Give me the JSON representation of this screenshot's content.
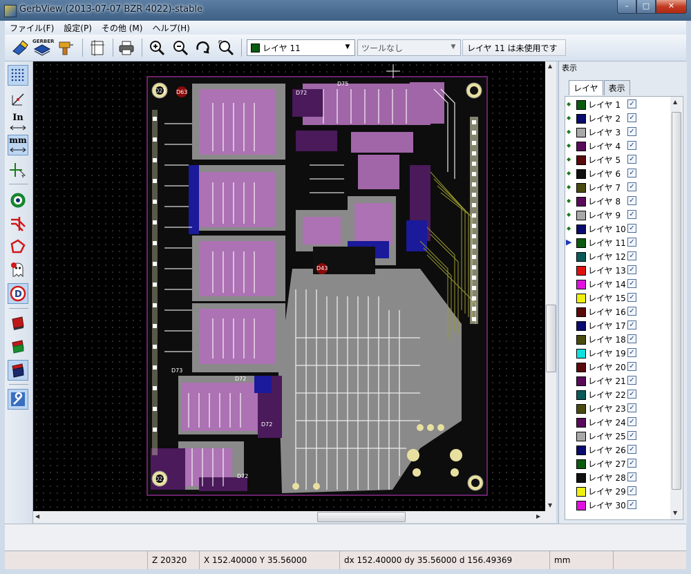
{
  "window": {
    "title": "GerbView (2013-07-07 BZR 4022)-stable",
    "min": "–",
    "max": "□",
    "close": "✕"
  },
  "menu": [
    "ファイル(F)",
    "設定(P)",
    "その他 (M)",
    "ヘルプ(H)"
  ],
  "toolbar": {
    "gerber_icon_text": "GERBER",
    "active_layer": "レイヤ 11",
    "tool_select": "ツールなし",
    "layer_status": "レイヤ 11 は未使用です"
  },
  "left_toolbar": {
    "inch_label": "In",
    "mm_label": "mm"
  },
  "right_panel": {
    "title": "表示",
    "tabs": [
      "レイヤ",
      "表示"
    ],
    "layers": [
      {
        "name": "レイヤ 1",
        "color": "#0b5a10"
      },
      {
        "name": "レイヤ 2",
        "color": "#0a0a70"
      },
      {
        "name": "レイヤ 3",
        "color": "#a8a8a8"
      },
      {
        "name": "レイヤ 4",
        "color": "#5a0a5a"
      },
      {
        "name": "レイヤ 5",
        "color": "#5a0a0a"
      },
      {
        "name": "レイヤ 6",
        "color": "#101010"
      },
      {
        "name": "レイヤ 7",
        "color": "#4a4a10"
      },
      {
        "name": "レイヤ 8",
        "color": "#5a0a5a"
      },
      {
        "name": "レイヤ 9",
        "color": "#a8a8a8"
      },
      {
        "name": "レイヤ 10",
        "color": "#0a0a70"
      },
      {
        "name": "レイヤ 11",
        "color": "#0b5a10"
      },
      {
        "name": "レイヤ 12",
        "color": "#0a5a5a"
      },
      {
        "name": "レイヤ 13",
        "color": "#e01010"
      },
      {
        "name": "レイヤ 14",
        "color": "#e010e0"
      },
      {
        "name": "レイヤ 15",
        "color": "#f0f010"
      },
      {
        "name": "レイヤ 16",
        "color": "#5a0a0a"
      },
      {
        "name": "レイヤ 17",
        "color": "#0a0a70"
      },
      {
        "name": "レイヤ 18",
        "color": "#4a4a10"
      },
      {
        "name": "レイヤ 19",
        "color": "#10e0e0"
      },
      {
        "name": "レイヤ 20",
        "color": "#5a0a0a"
      },
      {
        "name": "レイヤ 21",
        "color": "#5a0a5a"
      },
      {
        "name": "レイヤ 22",
        "color": "#0a5a5a"
      },
      {
        "name": "レイヤ 23",
        "color": "#4a4a10"
      },
      {
        "name": "レイヤ 24",
        "color": "#5a0a5a"
      },
      {
        "name": "レイヤ 25",
        "color": "#a8a8a8"
      },
      {
        "name": "レイヤ 26",
        "color": "#0a0a70"
      },
      {
        "name": "レイヤ 27",
        "color": "#0b5a10"
      },
      {
        "name": "レイヤ 28",
        "color": "#101010"
      },
      {
        "name": "レイヤ 29",
        "color": "#f0f010"
      },
      {
        "name": "レイヤ 30",
        "color": "#e010e0"
      }
    ]
  },
  "statusbar": {
    "zoom": "Z 20320",
    "xy": "X 152.40000  Y 35.56000",
    "delta": "dx 152.40000  dy 35.56000  d 156.49369",
    "units": "mm"
  },
  "board_labels": [
    "D21",
    "D63",
    "D72",
    "D75",
    "D43",
    "D73",
    "D72",
    "D72",
    "D22",
    "D72"
  ]
}
